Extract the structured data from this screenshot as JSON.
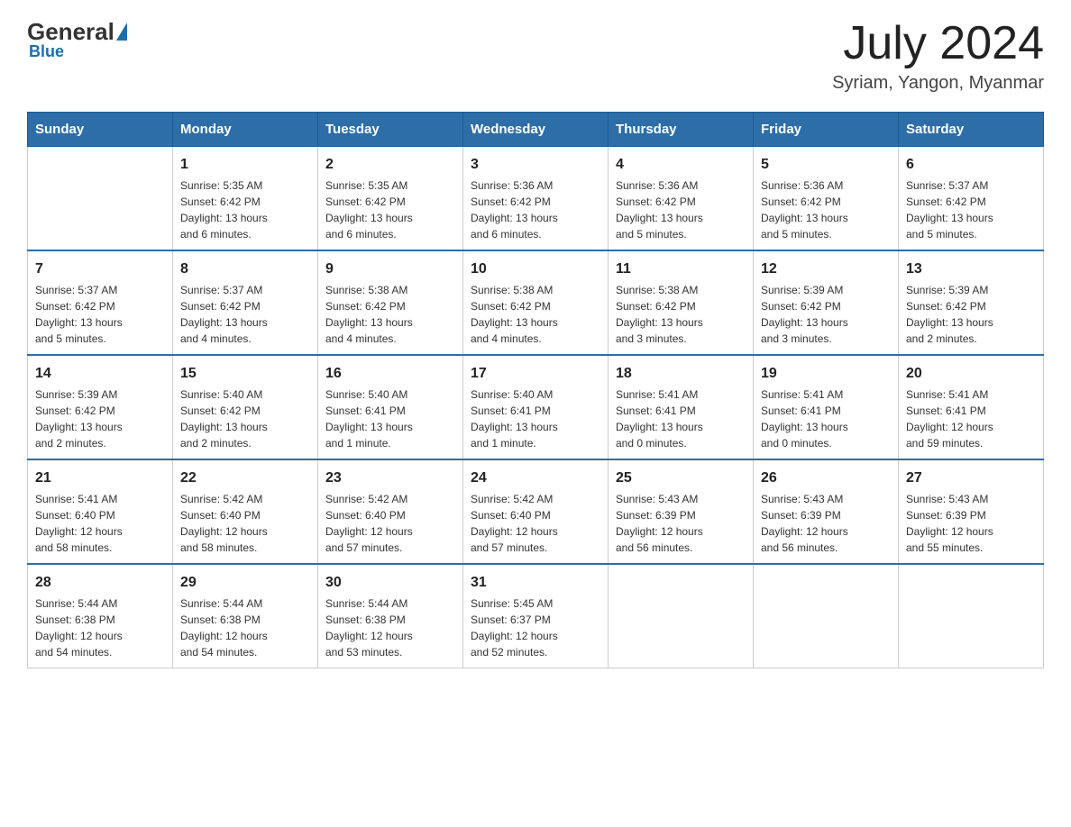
{
  "header": {
    "logo": {
      "general": "General",
      "blue": "Blue"
    },
    "title": "July 2024",
    "location": "Syriam, Yangon, Myanmar"
  },
  "calendar": {
    "headers": [
      "Sunday",
      "Monday",
      "Tuesday",
      "Wednesday",
      "Thursday",
      "Friday",
      "Saturday"
    ],
    "rows": [
      [
        {
          "day": "",
          "info": ""
        },
        {
          "day": "1",
          "info": "Sunrise: 5:35 AM\nSunset: 6:42 PM\nDaylight: 13 hours\nand 6 minutes."
        },
        {
          "day": "2",
          "info": "Sunrise: 5:35 AM\nSunset: 6:42 PM\nDaylight: 13 hours\nand 6 minutes."
        },
        {
          "day": "3",
          "info": "Sunrise: 5:36 AM\nSunset: 6:42 PM\nDaylight: 13 hours\nand 6 minutes."
        },
        {
          "day": "4",
          "info": "Sunrise: 5:36 AM\nSunset: 6:42 PM\nDaylight: 13 hours\nand 5 minutes."
        },
        {
          "day": "5",
          "info": "Sunrise: 5:36 AM\nSunset: 6:42 PM\nDaylight: 13 hours\nand 5 minutes."
        },
        {
          "day": "6",
          "info": "Sunrise: 5:37 AM\nSunset: 6:42 PM\nDaylight: 13 hours\nand 5 minutes."
        }
      ],
      [
        {
          "day": "7",
          "info": "Sunrise: 5:37 AM\nSunset: 6:42 PM\nDaylight: 13 hours\nand 5 minutes."
        },
        {
          "day": "8",
          "info": "Sunrise: 5:37 AM\nSunset: 6:42 PM\nDaylight: 13 hours\nand 4 minutes."
        },
        {
          "day": "9",
          "info": "Sunrise: 5:38 AM\nSunset: 6:42 PM\nDaylight: 13 hours\nand 4 minutes."
        },
        {
          "day": "10",
          "info": "Sunrise: 5:38 AM\nSunset: 6:42 PM\nDaylight: 13 hours\nand 4 minutes."
        },
        {
          "day": "11",
          "info": "Sunrise: 5:38 AM\nSunset: 6:42 PM\nDaylight: 13 hours\nand 3 minutes."
        },
        {
          "day": "12",
          "info": "Sunrise: 5:39 AM\nSunset: 6:42 PM\nDaylight: 13 hours\nand 3 minutes."
        },
        {
          "day": "13",
          "info": "Sunrise: 5:39 AM\nSunset: 6:42 PM\nDaylight: 13 hours\nand 2 minutes."
        }
      ],
      [
        {
          "day": "14",
          "info": "Sunrise: 5:39 AM\nSunset: 6:42 PM\nDaylight: 13 hours\nand 2 minutes."
        },
        {
          "day": "15",
          "info": "Sunrise: 5:40 AM\nSunset: 6:42 PM\nDaylight: 13 hours\nand 2 minutes."
        },
        {
          "day": "16",
          "info": "Sunrise: 5:40 AM\nSunset: 6:41 PM\nDaylight: 13 hours\nand 1 minute."
        },
        {
          "day": "17",
          "info": "Sunrise: 5:40 AM\nSunset: 6:41 PM\nDaylight: 13 hours\nand 1 minute."
        },
        {
          "day": "18",
          "info": "Sunrise: 5:41 AM\nSunset: 6:41 PM\nDaylight: 13 hours\nand 0 minutes."
        },
        {
          "day": "19",
          "info": "Sunrise: 5:41 AM\nSunset: 6:41 PM\nDaylight: 13 hours\nand 0 minutes."
        },
        {
          "day": "20",
          "info": "Sunrise: 5:41 AM\nSunset: 6:41 PM\nDaylight: 12 hours\nand 59 minutes."
        }
      ],
      [
        {
          "day": "21",
          "info": "Sunrise: 5:41 AM\nSunset: 6:40 PM\nDaylight: 12 hours\nand 58 minutes."
        },
        {
          "day": "22",
          "info": "Sunrise: 5:42 AM\nSunset: 6:40 PM\nDaylight: 12 hours\nand 58 minutes."
        },
        {
          "day": "23",
          "info": "Sunrise: 5:42 AM\nSunset: 6:40 PM\nDaylight: 12 hours\nand 57 minutes."
        },
        {
          "day": "24",
          "info": "Sunrise: 5:42 AM\nSunset: 6:40 PM\nDaylight: 12 hours\nand 57 minutes."
        },
        {
          "day": "25",
          "info": "Sunrise: 5:43 AM\nSunset: 6:39 PM\nDaylight: 12 hours\nand 56 minutes."
        },
        {
          "day": "26",
          "info": "Sunrise: 5:43 AM\nSunset: 6:39 PM\nDaylight: 12 hours\nand 56 minutes."
        },
        {
          "day": "27",
          "info": "Sunrise: 5:43 AM\nSunset: 6:39 PM\nDaylight: 12 hours\nand 55 minutes."
        }
      ],
      [
        {
          "day": "28",
          "info": "Sunrise: 5:44 AM\nSunset: 6:38 PM\nDaylight: 12 hours\nand 54 minutes."
        },
        {
          "day": "29",
          "info": "Sunrise: 5:44 AM\nSunset: 6:38 PM\nDaylight: 12 hours\nand 54 minutes."
        },
        {
          "day": "30",
          "info": "Sunrise: 5:44 AM\nSunset: 6:38 PM\nDaylight: 12 hours\nand 53 minutes."
        },
        {
          "day": "31",
          "info": "Sunrise: 5:45 AM\nSunset: 6:37 PM\nDaylight: 12 hours\nand 52 minutes."
        },
        {
          "day": "",
          "info": ""
        },
        {
          "day": "",
          "info": ""
        },
        {
          "day": "",
          "info": ""
        }
      ]
    ]
  }
}
